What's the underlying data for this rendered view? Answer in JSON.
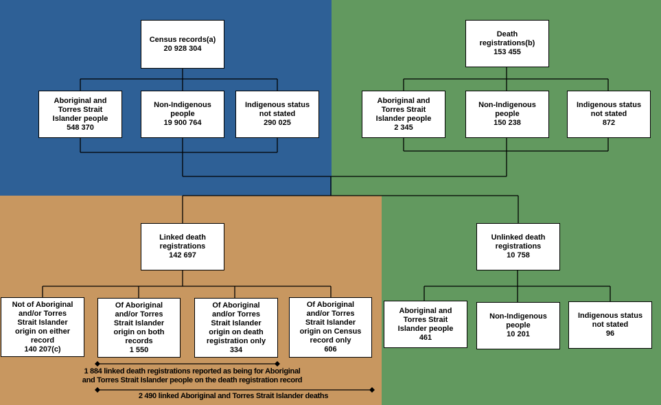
{
  "colors": {
    "census_region": "#2e6096",
    "death_region": "#62995f",
    "linked_region": "#c89760",
    "box_fill": "#ffffff",
    "line": "#000000"
  },
  "census": {
    "title": "Census records(a)",
    "value": "20 928 304",
    "children": [
      {
        "label_lines": [
          "Aboriginal and",
          "Torres Strait",
          "Islander people"
        ],
        "value": "548 370"
      },
      {
        "label_lines": [
          "Non-Indigenous",
          "people"
        ],
        "value": "19 900 764"
      },
      {
        "label_lines": [
          "Indigenous status",
          "not stated"
        ],
        "value": "290 025"
      }
    ]
  },
  "deaths": {
    "title_lines": [
      "Death",
      "registrations(b)"
    ],
    "value": "153 455",
    "children": [
      {
        "label_lines": [
          "Aboriginal and",
          "Torres Strait",
          "Islander people"
        ],
        "value": "2 345"
      },
      {
        "label_lines": [
          "Non-Indigenous",
          "people"
        ],
        "value": "150 238"
      },
      {
        "label_lines": [
          "Indigenous status",
          "not stated"
        ],
        "value": "872"
      }
    ]
  },
  "linked": {
    "title_lines": [
      "Linked death",
      "registrations"
    ],
    "value": "142 697",
    "children": [
      {
        "label_lines": [
          "Not of Aboriginal",
          "and/or Torres",
          "Strait Islander",
          "origin on either",
          "record"
        ],
        "value": "140 207(c)"
      },
      {
        "label_lines": [
          "Of Aboriginal",
          "and/or Torres",
          "Strait Islander",
          "origin on both",
          "records"
        ],
        "value": "1 550"
      },
      {
        "label_lines": [
          "Of Aboriginal",
          "and/or Torres",
          "Strait Islander",
          "origin on death",
          "registration only"
        ],
        "value": "334"
      },
      {
        "label_lines": [
          "Of Aboriginal",
          "and/or Torres",
          "Strait Islander",
          "origin on Census",
          "record only"
        ],
        "value": "606"
      }
    ],
    "annotation_1_lines": [
      "1 884 linked death registrations reported as being for Aboriginal",
      "and Torres Strait Islander people on the death registration record"
    ],
    "annotation_2": "2 490 linked Aboriginal and Torres Strait Islander deaths"
  },
  "unlinked": {
    "title_lines": [
      "Unlinked death",
      "registrations"
    ],
    "value": "10 758",
    "children": [
      {
        "label_lines": [
          "Aboriginal and",
          "Torres Strait",
          "Islander people"
        ],
        "value": "461"
      },
      {
        "label_lines": [
          "Non-Indigenous",
          "people"
        ],
        "value": "10 201"
      },
      {
        "label_lines": [
          "Indigenous status",
          "not stated"
        ],
        "value": "96"
      }
    ]
  }
}
